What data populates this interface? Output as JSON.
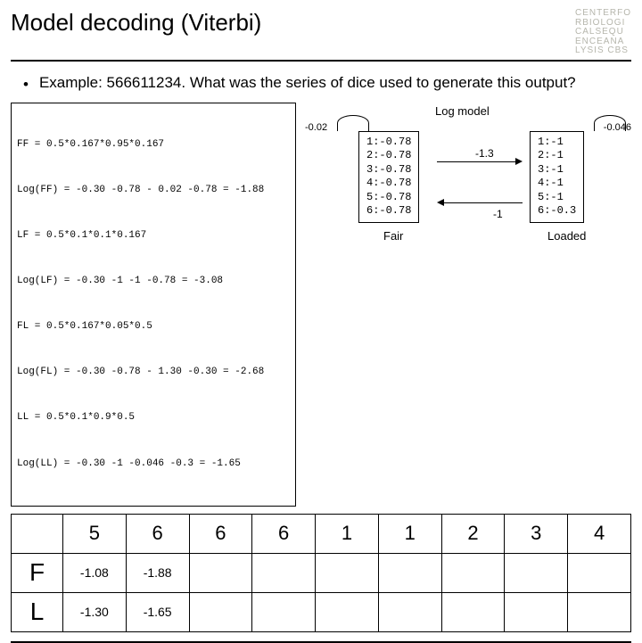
{
  "header": {
    "title": "Model decoding (Viterbi)",
    "brand": "CENTERFO\nRBIOLOGI\nCALSEQU\nENCEANA\nLYSIS CBS"
  },
  "example": {
    "bullet": "•",
    "text": "Example: 566611234. What was the series of dice used to generate this output?"
  },
  "calc": {
    "l1": "FF = 0.5*0.167*0.95*0.167",
    "l2": "Log(FF) = -0.30 -0.78 - 0.02 -0.78 = -1.88",
    "l3": "LF = 0.5*0.1*0.1*0.167",
    "l4": "Log(LF) = -0.30 -1 -1 -0.78 = -3.08",
    "l5": "FL = 0.5*0.167*0.05*0.5",
    "l6": "Log(FL) = -0.30 -0.78 - 1.30 -0.30 = -2.68",
    "l7": "LL = 0.5*0.1*0.9*0.5",
    "l8": "Log(LL) = -0.30 -1 -0.046 -0.3 = -1.65"
  },
  "model": {
    "label": "Log model",
    "self_fair": "-0.02",
    "self_loaded": "-0.046",
    "trans_fl": "-1.3",
    "trans_lf": "-1",
    "fair_label": "Fair",
    "loaded_label": "Loaded",
    "fair_probs": "1:-0.78\n2:-0.78\n3:-0.78\n4:-0.78\n5:-0.78\n6:-0.78",
    "loaded_probs": "1:-1\n2:-1\n3:-1\n4:-1\n5:-1\n6:-0.3"
  },
  "table": {
    "cols": [
      "5",
      "6",
      "6",
      "6",
      "1",
      "1",
      "2",
      "3",
      "4"
    ],
    "row_f": "F",
    "row_l": "L",
    "f_vals": [
      "-1.08",
      "-1.88",
      "",
      "",
      "",
      "",
      "",
      "",
      ""
    ],
    "l_vals": [
      "-1.30",
      "-1.65",
      "",
      "",
      "",
      "",
      "",
      "",
      ""
    ]
  }
}
